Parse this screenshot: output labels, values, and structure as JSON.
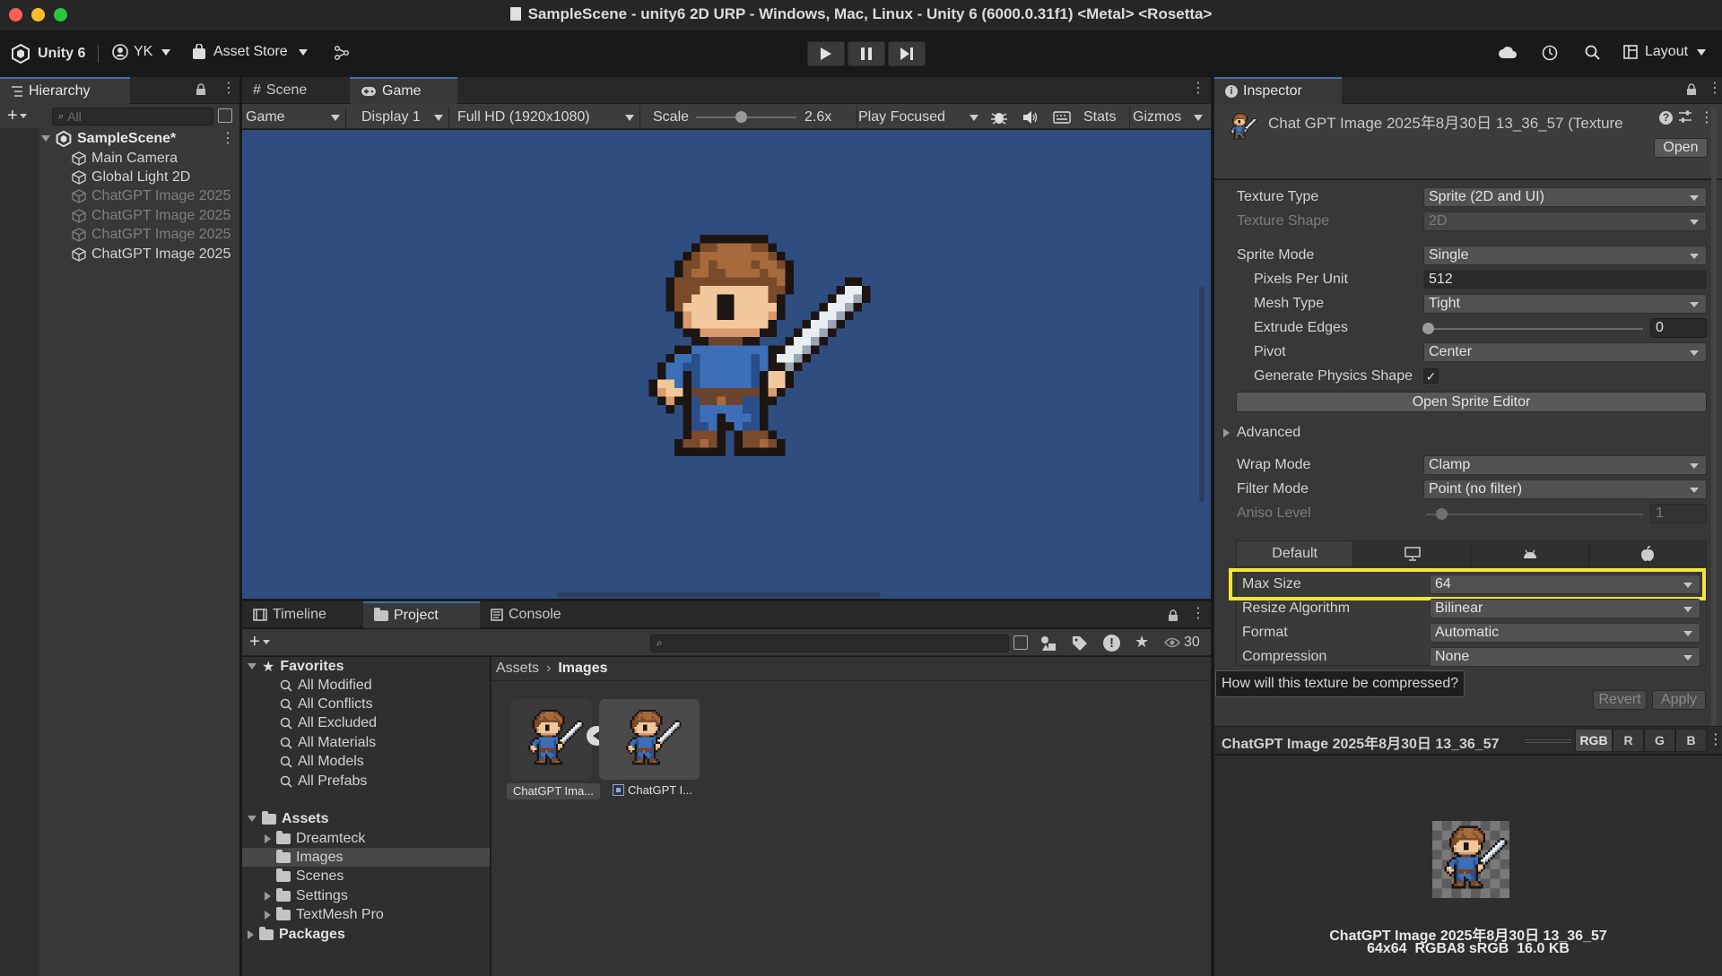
{
  "window": {
    "title": "SampleScene - unity6 2D URP - Windows, Mac, Linux - Unity 6 (6000.0.31f1) <Metal> <Rosetta>"
  },
  "toolbar": {
    "unity_label": "Unity 6",
    "account_label": "YK",
    "asset_store_label": "Asset Store",
    "layout_label": "Layout"
  },
  "hierarchy": {
    "tab_label": "Hierarchy",
    "search_placeholder": "All",
    "scene_name": "SampleScene*",
    "items": [
      {
        "label": "Main Camera",
        "dim": false
      },
      {
        "label": "Global Light 2D",
        "dim": false
      },
      {
        "label": "ChatGPT Image 2025",
        "dim": true
      },
      {
        "label": "ChatGPT Image 2025",
        "dim": true
      },
      {
        "label": "ChatGPT Image 2025",
        "dim": true
      },
      {
        "label": "ChatGPT Image 2025",
        "dim": false
      }
    ]
  },
  "game": {
    "tabs": [
      "Scene",
      "Game"
    ],
    "view_select": "Game",
    "display_select": "Display 1",
    "resolution_select": "Full HD (1920x1080)",
    "scale_label": "Scale",
    "scale_value": "2.6x",
    "scale_level": 0.45,
    "play_mode_select": "Play Focused",
    "stats_label": "Stats",
    "gizmos_label": "Gizmos",
    "bg_color": "#304d80"
  },
  "inspector": {
    "tab_label": "Inspector",
    "asset_title": "Chat GPT Image 2025年8月30日 13_36_57 (Texture",
    "open_button": "Open",
    "rows": {
      "texture_type": {
        "label": "Texture Type",
        "value": "Sprite (2D and UI)"
      },
      "texture_shape": {
        "label": "Texture Shape",
        "value": "2D"
      },
      "sprite_mode": {
        "label": "Sprite Mode",
        "value": "Single"
      },
      "pixels_per_unit": {
        "label": "Pixels Per Unit",
        "value": "512"
      },
      "mesh_type": {
        "label": "Mesh Type",
        "value": "Tight"
      },
      "extrude_edges": {
        "label": "Extrude Edges",
        "value": "0"
      },
      "pivot": {
        "label": "Pivot",
        "value": "Center"
      },
      "generate_physics": {
        "label": "Generate Physics Shape",
        "checked": true
      },
      "wrap_mode": {
        "label": "Wrap Mode",
        "value": "Clamp"
      },
      "filter_mode": {
        "label": "Filter Mode",
        "value": "Point (no filter)"
      },
      "aniso_level": {
        "label": "Aniso Level",
        "value": "1"
      }
    },
    "open_sprite_editor": "Open Sprite Editor",
    "advanced_label": "Advanced",
    "platform_tabs": {
      "default": "Default"
    },
    "platform_rows": {
      "max_size": {
        "label": "Max Size",
        "value": "64"
      },
      "resize_algorithm": {
        "label": "Resize Algorithm",
        "value": "Bilinear"
      },
      "format": {
        "label": "Format",
        "value": "Automatic"
      },
      "compression": {
        "label": "Compression",
        "value": "None"
      }
    },
    "tooltip": "How will this texture be compressed?",
    "revert_button": "Revert",
    "apply_button": "Apply",
    "preview": {
      "title": "ChatGPT Image 2025年8月30日 13_36_57",
      "channels": [
        "RGB",
        "R",
        "G",
        "B"
      ],
      "caption_name": "ChatGPT Image 2025年8月30日 13_36_57",
      "caption_info": "64x64  RGBA8 sRGB  16.0 KB"
    },
    "highlight_color": "#f5e636"
  },
  "bottom": {
    "tabs": [
      "Timeline",
      "Project",
      "Console"
    ],
    "visible_count": "30",
    "breadcrumb_root": "Assets",
    "breadcrumb_current": "Images",
    "favorites_label": "Favorites",
    "favorites": [
      "All Modified",
      "All Conflicts",
      "All Excluded",
      "All Materials",
      "All Models",
      "All Prefabs"
    ],
    "assets_label": "Assets",
    "asset_folders": [
      "Dreamteck",
      "Images",
      "Scenes",
      "Settings",
      "TextMesh Pro"
    ],
    "packages_label": "Packages",
    "files": [
      "ChatGPT Ima...",
      "ChatGPT I..."
    ]
  }
}
